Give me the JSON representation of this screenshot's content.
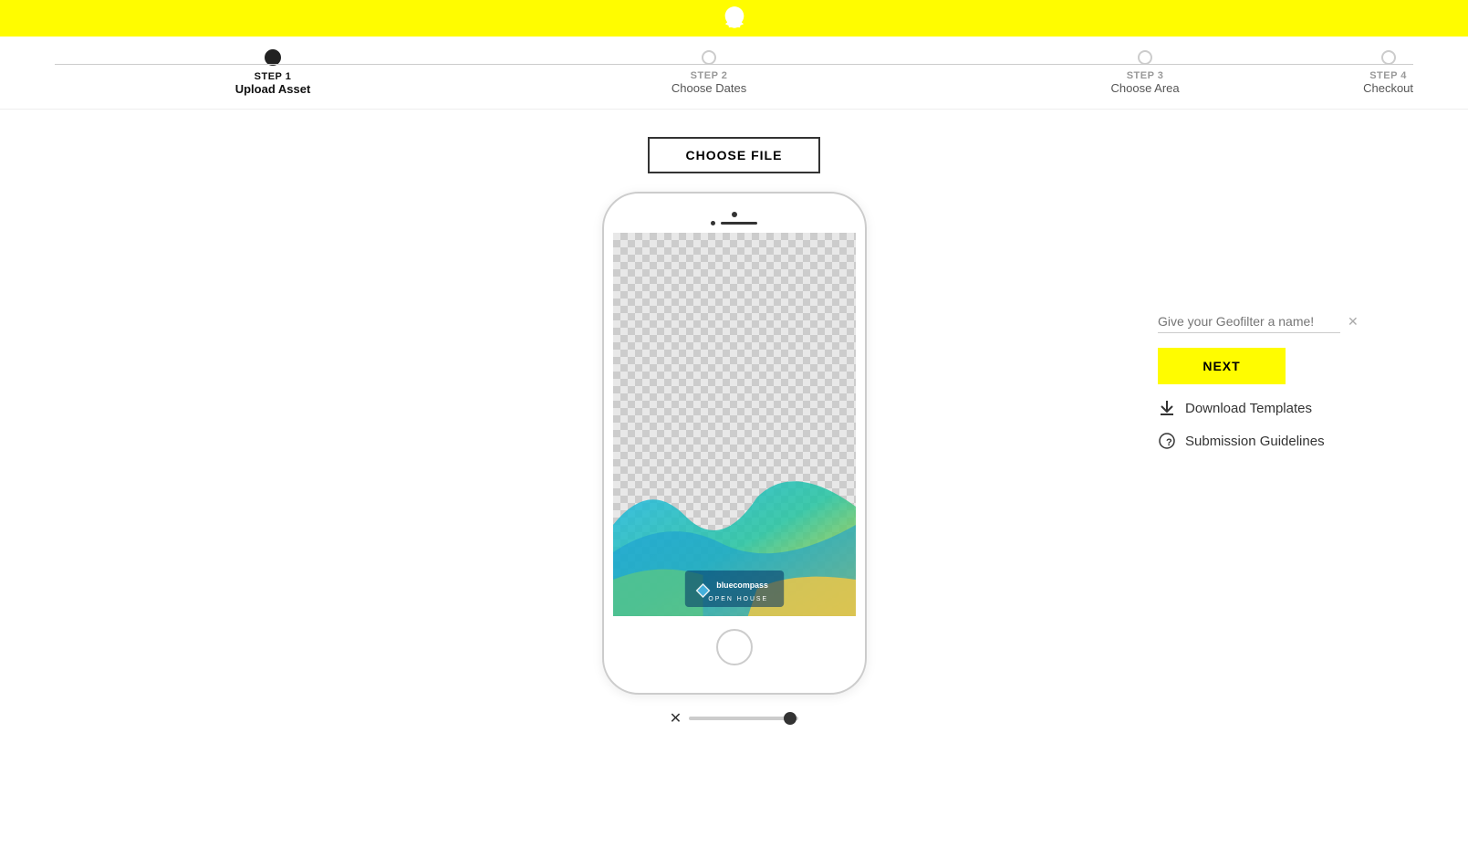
{
  "header": {
    "logo_alt": "Snapchat"
  },
  "steps": [
    {
      "id": "step1",
      "number": "STEP 1",
      "label": "Upload Asset",
      "active": true
    },
    {
      "id": "step2",
      "number": "STEP 2",
      "label": "Choose Dates",
      "active": false
    },
    {
      "id": "step3",
      "number": "STEP 3",
      "label": "Choose Area",
      "active": false
    },
    {
      "id": "step4",
      "number": "STEP 4",
      "label": "Checkout",
      "active": false
    }
  ],
  "main": {
    "choose_file_label": "CHOOSE FILE",
    "geofilter_name_placeholder": "Give your Geofilter a name!",
    "next_label": "NEXT",
    "download_templates_label": "Download Templates",
    "submission_guidelines_label": "Submission Guidelines"
  },
  "colors": {
    "yellow": "#FFFC00",
    "active_step": "#222222",
    "inactive_step": "#cccccc"
  }
}
